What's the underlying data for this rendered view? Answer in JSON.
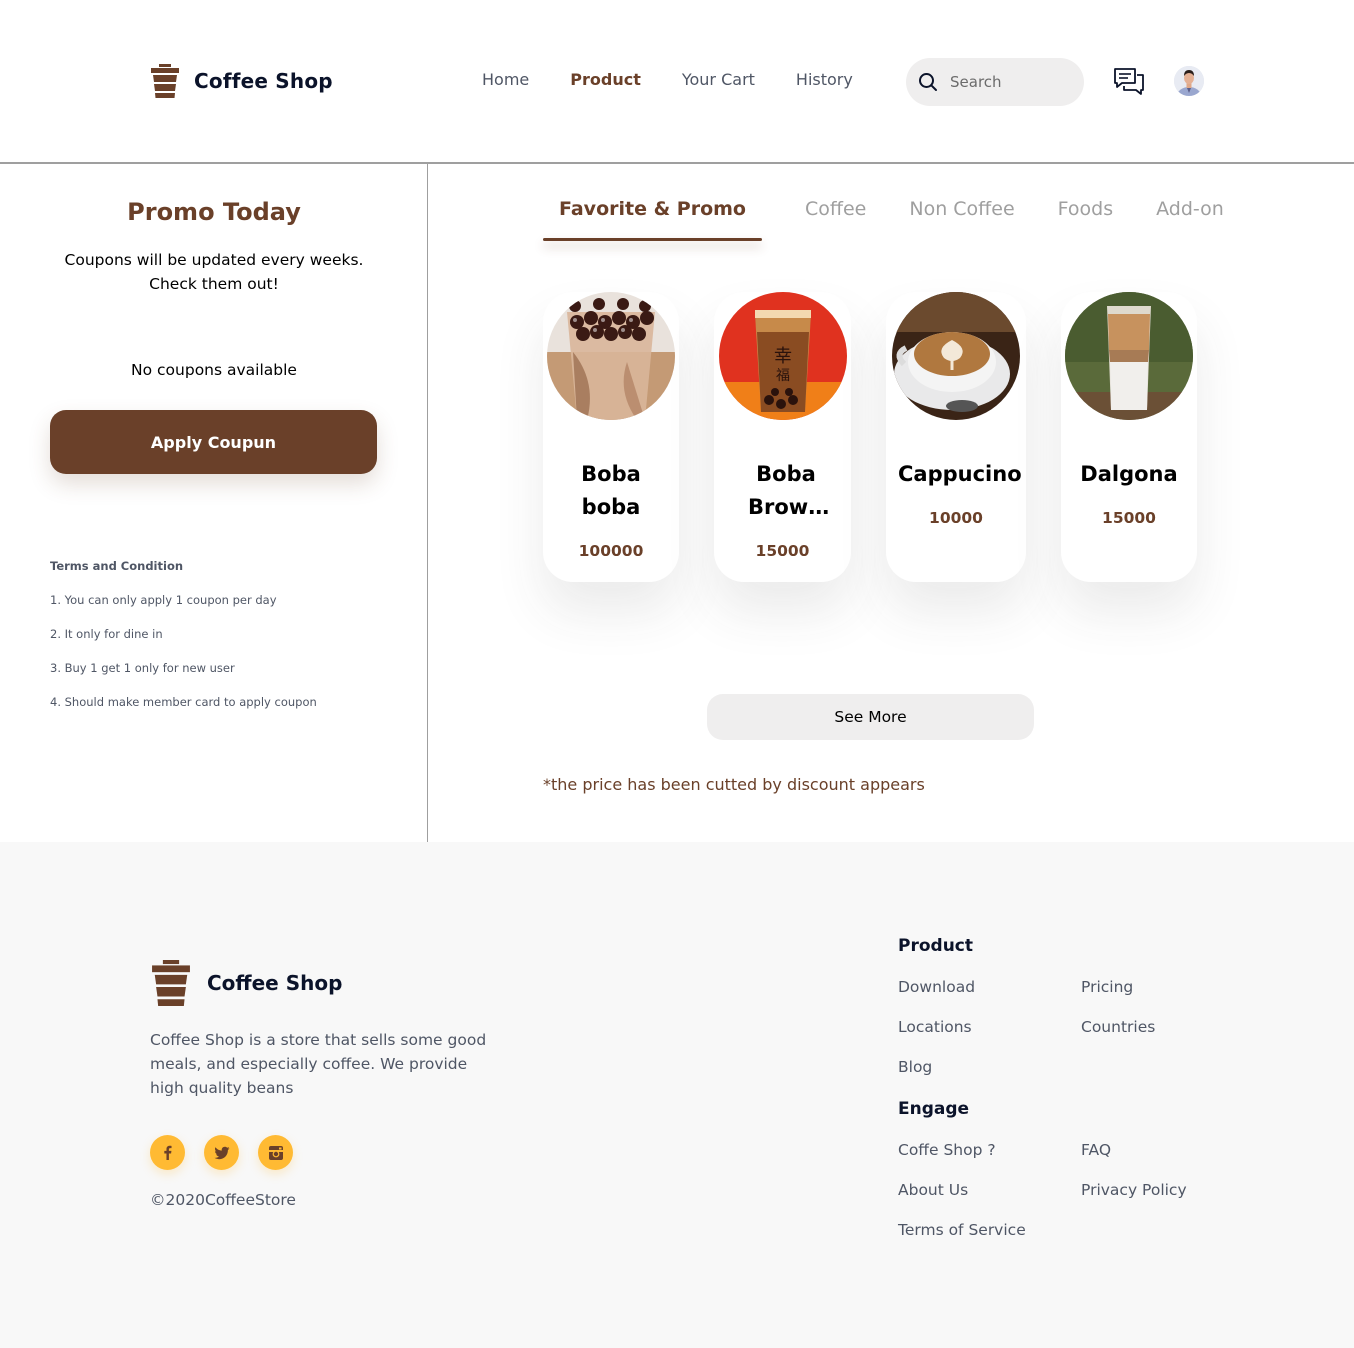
{
  "header": {
    "brand": "Coffee Shop",
    "nav": [
      "Home",
      "Product",
      "Your Cart",
      "History"
    ],
    "active_nav": "Product",
    "search_placeholder": "Search"
  },
  "promo": {
    "title": "Promo Today",
    "description": "Coupons will be updated every weeks. Check them out!",
    "empty_text": "No coupons available",
    "apply_label": "Apply Coupun",
    "terms_title": "Terms and Condition",
    "terms": [
      "1. You can only apply 1 coupon per day",
      "2. It only for dine in",
      "3. Buy 1 get 1 only for new user",
      "4. Should make member card to apply coupon"
    ]
  },
  "tabs": [
    "Favorite & Promo",
    "Coffee",
    "Non Coffee",
    "Foods",
    "Add-on"
  ],
  "active_tab": "Favorite & Promo",
  "products": [
    {
      "name": "Boba boba",
      "price": "100000"
    },
    {
      "name": "Boba Brow…",
      "price": "15000"
    },
    {
      "name": "Cappucino",
      "price": "10000"
    },
    {
      "name": "Dalgona",
      "price": "15000"
    }
  ],
  "see_more_label": "See More",
  "discount_note": "*the price has been cutted by discount appears",
  "footer": {
    "brand": "Coffee Shop",
    "description": "Coffee Shop is a store that sells some good meals, and especially coffee. We provide high quality beans",
    "copyright": "©2020CoffeeStore",
    "socials": [
      "facebook-icon",
      "twitter-icon",
      "instagram-icon"
    ],
    "product_title": "Product",
    "product_links": [
      "Download",
      "Pricing",
      "Locations",
      "Countries",
      "Blog"
    ],
    "engage_title": "Engage",
    "engage_links": [
      "Coffe Shop ?",
      "FAQ",
      "About Us",
      "Privacy Policy",
      "Terms of Service"
    ]
  },
  "colors": {
    "brand_brown": "#6a4029",
    "accent_yellow": "#ffba33",
    "text_dark": "#0b132a",
    "text_gray": "#4f5665",
    "tab_inactive": "#9f9f9f"
  }
}
